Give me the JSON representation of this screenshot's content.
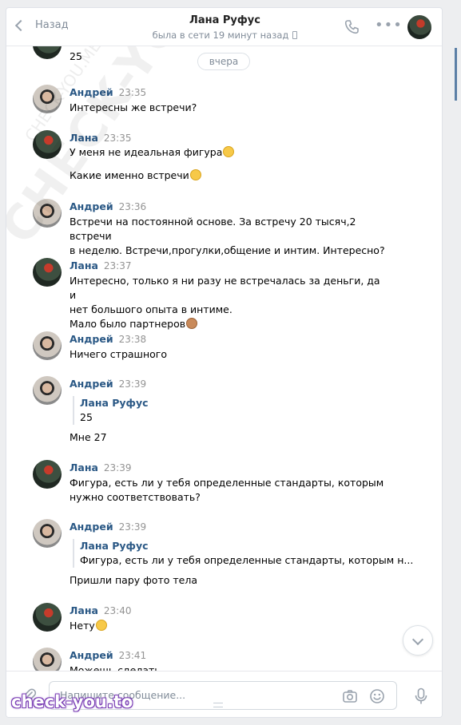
{
  "header": {
    "back_label": "Назад",
    "contact_name": "Лана Руфус",
    "status": "была в сети 19 минут назад"
  },
  "feed": {
    "top_fragment": "25",
    "date_pill": "вчера",
    "messages": [
      {
        "author": "Андрей",
        "time": "23:35",
        "lines": [
          "Интересны же встречи?"
        ]
      },
      {
        "author": "Лана",
        "time": "23:35",
        "lines": [
          "У меня не идеальная фигура"
        ],
        "extra": "Какие именно встречи"
      },
      {
        "author": "Андрей",
        "time": "23:36",
        "lines": [
          "Встречи на постоянной основе. За встречу 20 тысяч,2 встречи",
          "в неделю. Встречи,прогулки,общение и интим. Интересно?"
        ]
      },
      {
        "author": "Лана",
        "time": "23:37",
        "lines": [
          "Интересно, только я ни разу не встречалась за деньги, да и",
          "нет большого опыта в интиме.",
          "Мало было партнеров"
        ]
      },
      {
        "author": "Андрей",
        "time": "23:38",
        "lines": [
          "Ничего страшного"
        ]
      },
      {
        "author": "Андрей",
        "time": "23:39",
        "quote_name": "Лана Руфус",
        "quote_text": "25",
        "lines": [
          "Мне 27"
        ]
      },
      {
        "author": "Лана",
        "time": "23:39",
        "lines": [
          "Фигура, есть ли у тебя определенные стандарты, которым",
          "нужно соответствовать?"
        ]
      },
      {
        "author": "Андрей",
        "time": "23:39",
        "quote_name": "Лана Руфус",
        "quote_text": "Фигура, есть ли у тебя определенные стандарты, которым н...",
        "lines": [
          "Пришли пару фото тела"
        ]
      },
      {
        "author": "Лана",
        "time": "23:40",
        "lines": [
          "Нету"
        ]
      },
      {
        "author": "Андрей",
        "time": "23:41",
        "lines": [
          "Можешь сделать"
        ]
      }
    ]
  },
  "composer": {
    "placeholder": "Напишите сообщение..."
  },
  "watermark": {
    "diagonal": "CHECK-YOU.ME",
    "small": "CHECK-YOU.ME",
    "badge": "check-you.to"
  },
  "colors": {
    "name_link": "#2a5885",
    "muted": "#818c99",
    "badge_outline": "#7b3fb5"
  },
  "icons": [
    "back-chevron-icon",
    "phone-icon",
    "more-icon",
    "mobile-icon",
    "paperclip-icon",
    "camera-icon",
    "smile-icon",
    "microphone-icon",
    "chevron-down-icon"
  ]
}
